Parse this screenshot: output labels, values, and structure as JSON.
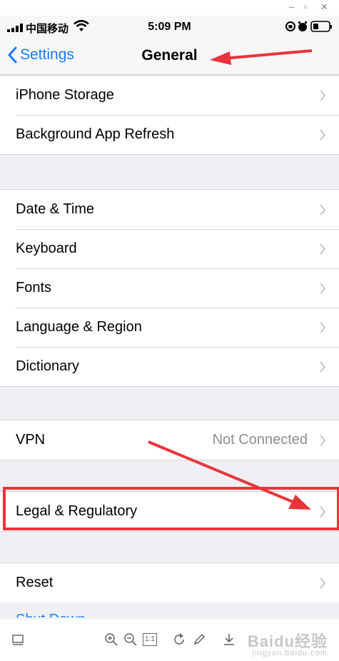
{
  "status_bar": {
    "carrier": "中国移动",
    "time": "5:09 PM"
  },
  "nav": {
    "back_label": "Settings",
    "title": "General"
  },
  "groups": [
    {
      "items": [
        {
          "label": "iPhone Storage",
          "value": ""
        },
        {
          "label": "Background App Refresh",
          "value": ""
        }
      ]
    },
    {
      "items": [
        {
          "label": "Date & Time",
          "value": ""
        },
        {
          "label": "Keyboard",
          "value": ""
        },
        {
          "label": "Fonts",
          "value": ""
        },
        {
          "label": "Language & Region",
          "value": ""
        },
        {
          "label": "Dictionary",
          "value": ""
        }
      ]
    },
    {
      "items": [
        {
          "label": "VPN",
          "value": "Not Connected"
        }
      ]
    },
    {
      "items": [
        {
          "label": "Legal & Regulatory",
          "value": ""
        }
      ]
    },
    {
      "items": [
        {
          "label": "Reset",
          "value": ""
        }
      ]
    }
  ],
  "shutdown_label": "Shut Down",
  "annotation_color": "#e8343c",
  "toolbar": {
    "zoom_ratio": "1:1",
    "watermark": "Baidu经验",
    "watermark_sub": "jingyan.baidu.com"
  }
}
